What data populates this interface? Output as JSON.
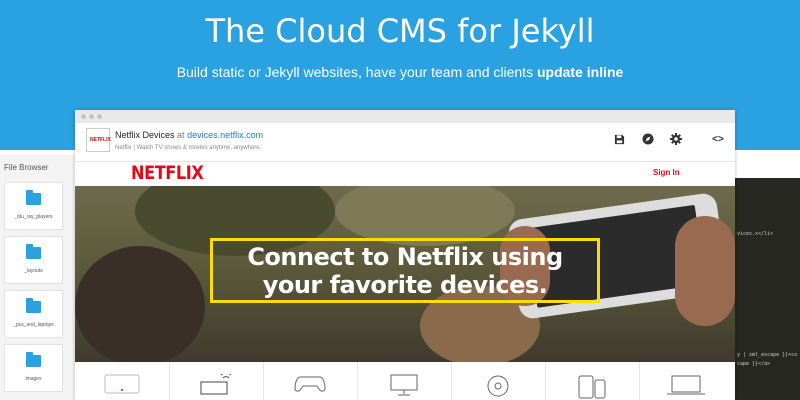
{
  "hero": {
    "title": "The Cloud CMS for Jekyll",
    "subtitle": "Build static or Jekyll websites, have your team and clients",
    "subtitle_bold": "update inline",
    "background": "#2aa1e0"
  },
  "file_browser": {
    "title": "File Browser",
    "folders": [
      "_blu_ray_players",
      "_layouts",
      "_pcs_and_laptops",
      "images"
    ]
  },
  "cms_bar": {
    "site_name": "Netflix Devices",
    "at_text": "at",
    "site_url": "devices.netflix.com",
    "site_description": "Netflix | Watch TV shows & movies anytime, anywhere.",
    "thumb_text": "NETFLIX",
    "icons": [
      "save-icon",
      "compass-icon",
      "gear-icon",
      "code-icon"
    ]
  },
  "netflix": {
    "logo": "NETFLIX",
    "sign_in": "Sign In",
    "brand_color": "#e50914",
    "promo_line1": "Connect to Netflix using",
    "promo_line2": "your favorite devices.",
    "promo_border_color": "#ffdd00"
  },
  "devices": [
    "tv-icon",
    "set-top-box-icon",
    "game-controller-icon",
    "monitor-icon",
    "disc-icon",
    "tablet-phone-icon",
    "laptop-icon"
  ],
  "code_panel": {
    "lines": [
      "vices.x</li>",
      "y | xml_escape }}<co",
      "cape }}</a>"
    ]
  }
}
